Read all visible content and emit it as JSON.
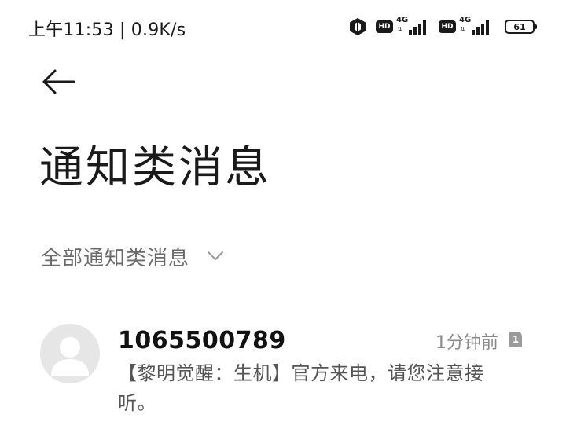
{
  "status_bar": {
    "left_text": "上午11:53 | 0.9K/s",
    "network_1": "4G",
    "network_2": "4G",
    "hd_label": "HD",
    "battery": "61",
    "icons": [
      "hexagon-app-icon",
      "hd-icon",
      "signal-icon",
      "hd-icon",
      "signal-icon",
      "battery-icon"
    ]
  },
  "header": {
    "back_icon": "arrow-left-icon",
    "title": "通知类消息"
  },
  "filter": {
    "selected": "全部通知类消息",
    "icon": "chevron-down-icon"
  },
  "messages": [
    {
      "sender": "1065500789",
      "time": "1分钟前",
      "sim": "1",
      "preview": "【黎明觉醒：生机】官方来电，请您注意接听。",
      "avatar_icon": "default-avatar-icon"
    }
  ],
  "colors": {
    "text_primary": "#1a1a1a",
    "text_secondary": "#6b6b6b",
    "text_tertiary": "#8a8a8a",
    "avatar_bg": "#e6e6e6",
    "background": "#ffffff"
  }
}
